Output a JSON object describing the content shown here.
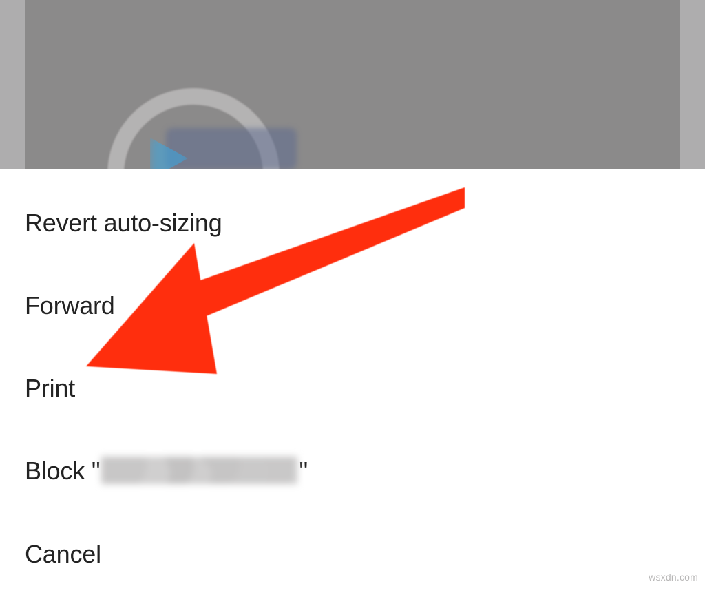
{
  "sheet": {
    "items": [
      {
        "label": "Revert auto-sizing"
      },
      {
        "label": "Forward"
      },
      {
        "label": "Print"
      },
      {
        "label_prefix": "Block \"",
        "label_suffix": "\""
      },
      {
        "label": "Cancel"
      }
    ]
  },
  "annotation": {
    "arrow_color": "#ff2d0f"
  },
  "watermark": "wsxdn.com"
}
